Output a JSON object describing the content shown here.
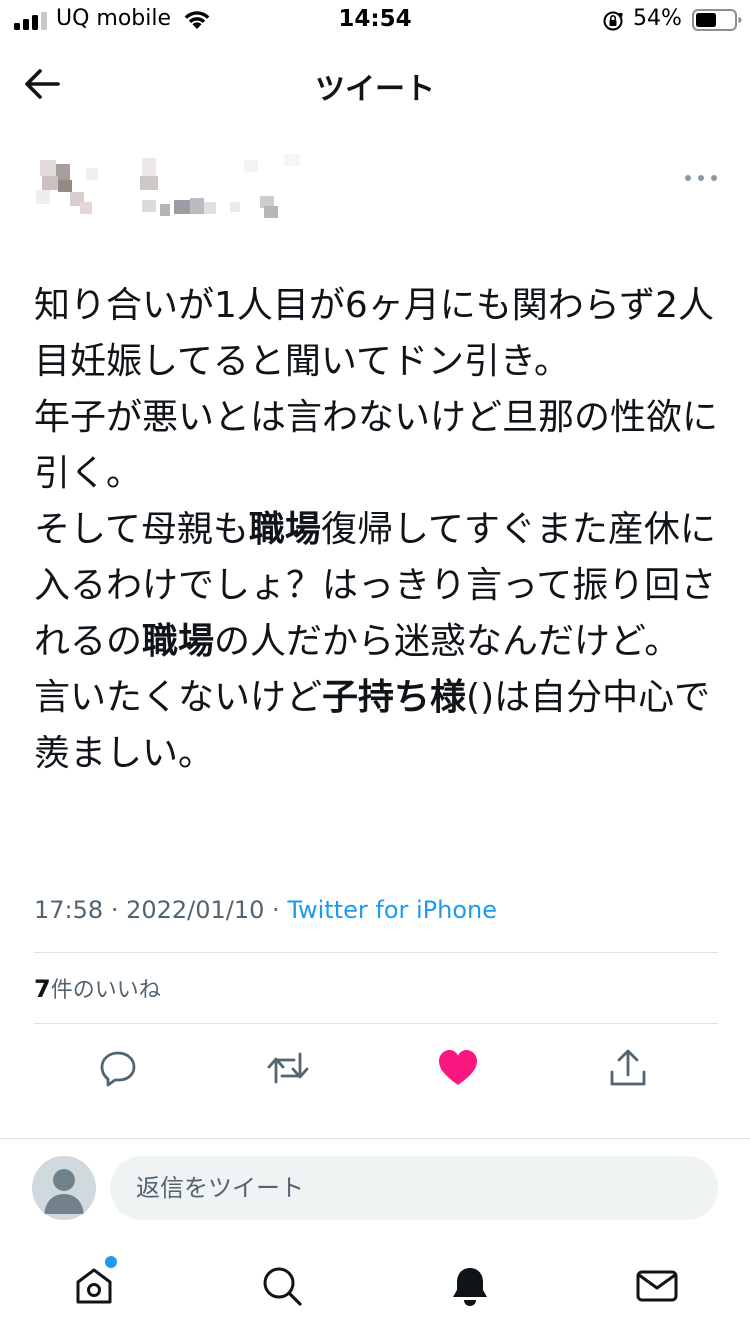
{
  "status_bar": {
    "carrier": "UQ mobile",
    "time": "14:54",
    "battery": "54%"
  },
  "header": {
    "title": "ツイート"
  },
  "tweet": {
    "segments": [
      {
        "text": "知り合いが1人目が6ヶ月にも関わらず2人目妊娠してると聞いてドン引き。\n年子が悪いとは言わないけど旦那の性欲に引く。\nそして母親も",
        "bold": false
      },
      {
        "text": "職場",
        "bold": true
      },
      {
        "text": "復帰してすぐまた産休に入るわけでしょ？はっきり言って振り回されるの",
        "bold": false
      },
      {
        "text": "職場",
        "bold": true
      },
      {
        "text": "の人だから迷惑なんだけど。\n言いたくないけど",
        "bold": false
      },
      {
        "text": "子持ち様",
        "bold": true
      },
      {
        "text": "()は自分中心で羨ましい。",
        "bold": false
      }
    ],
    "time": "17:58",
    "date": "2022/01/10",
    "source": "Twitter for iPhone",
    "likes_count": "7",
    "likes_label": "件のいいね",
    "liked": true
  },
  "reply": {
    "placeholder": "返信をツイート"
  },
  "colors": {
    "accent": "#1d9bf0",
    "like": "#f91880",
    "icon": "#536471",
    "text": "#0f1419"
  },
  "icons": {
    "back": "arrow-left-icon",
    "more": "more-dots-icon",
    "reply": "reply-icon",
    "retweet": "retweet-icon",
    "like": "heart-icon",
    "share": "share-icon",
    "home": "home-icon",
    "search": "search-icon",
    "notifications": "bell-icon",
    "messages": "envelope-icon"
  }
}
